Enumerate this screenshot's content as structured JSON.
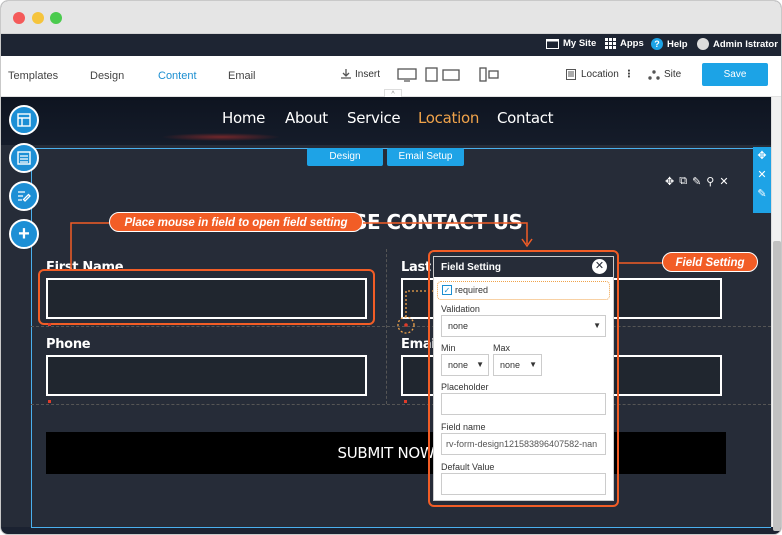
{
  "topbar": {
    "my_site": "My Site",
    "apps": "Apps",
    "help": "Help",
    "user": "Admin Istrator"
  },
  "toolbar": {
    "tabs": [
      "Templates",
      "Design",
      "Content",
      "Email"
    ],
    "insert": "Insert",
    "location": "Location",
    "site": "Site",
    "save": "Save"
  },
  "nav": {
    "items": [
      "Home",
      "About",
      "Service",
      "Location",
      "Contact"
    ],
    "active": "Location"
  },
  "form_tabs": {
    "design": "Design",
    "email_setup": "Email Setup"
  },
  "form": {
    "heading": "PLEASE CONTACT US",
    "first_name": "First Name",
    "last_name": "Last N",
    "phone": "Phone",
    "email": "Email",
    "submit": "SUBMIT NOW"
  },
  "callouts": {
    "field_hint": "Place mouse in field to open field setting",
    "field_setting": "Field Setting"
  },
  "field_setting": {
    "title": "Field Setting",
    "required_label": "required",
    "required_checked": true,
    "validation_label": "Validation",
    "validation_value": "none",
    "min_label": "Min",
    "min_value": "none",
    "max_label": "Max",
    "max_value": "none",
    "placeholder_label": "Placeholder",
    "placeholder_value": "",
    "field_name_label": "Field name",
    "field_name_value": "rv-form-design121583896407582-nan",
    "default_value_label": "Default Value",
    "default_value_value": ""
  },
  "colors": {
    "accent_blue": "#1ca3e6",
    "callout_orange": "#f25d26",
    "nav_active": "#f0a34a",
    "dark_bg": "#262c38"
  }
}
